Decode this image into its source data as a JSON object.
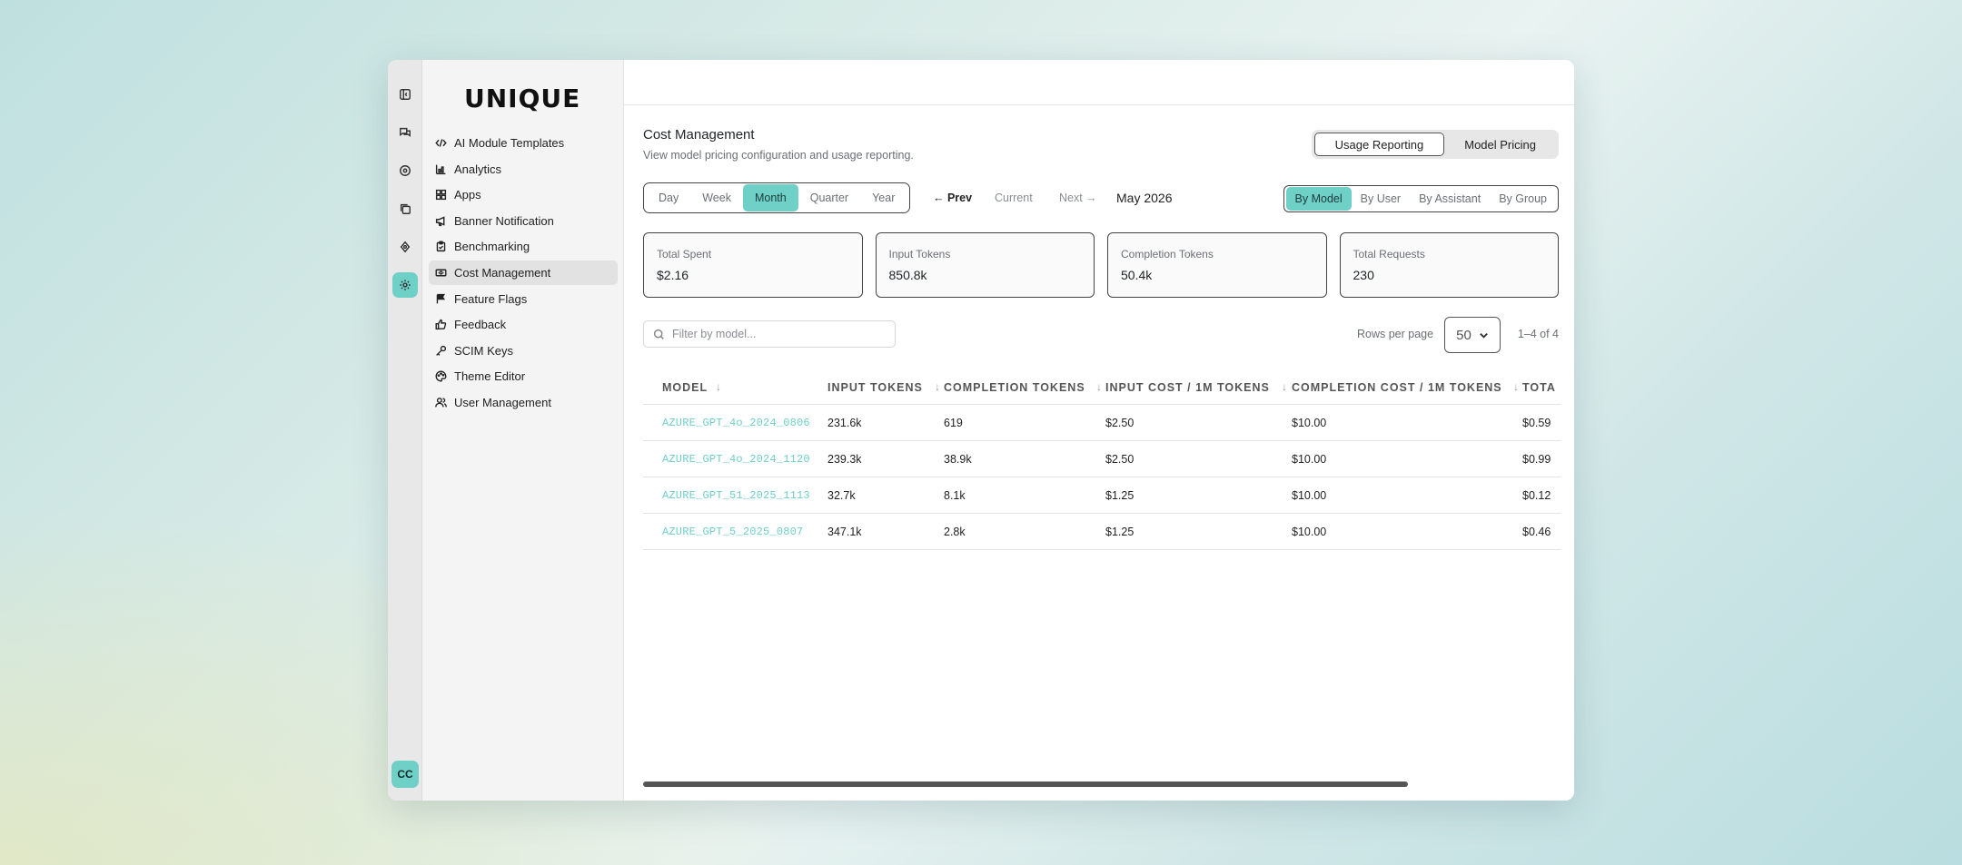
{
  "brand": {
    "logo_text": "UNIQUE",
    "accent": "#6fd0c8"
  },
  "rail": {
    "icons": [
      "collapse-sidebar-icon",
      "chat-icon",
      "explore-icon",
      "copy-icon",
      "ai-icon",
      "settings-icon"
    ],
    "avatar_initials": "CC"
  },
  "sidebar": {
    "items": [
      {
        "label": "AI Module Templates",
        "icon": "code-icon"
      },
      {
        "label": "Analytics",
        "icon": "bar-chart-icon"
      },
      {
        "label": "Apps",
        "icon": "grid-icon"
      },
      {
        "label": "Banner Notification",
        "icon": "megaphone-icon"
      },
      {
        "label": "Benchmarking",
        "icon": "clipboard-check-icon"
      },
      {
        "label": "Cost Management",
        "icon": "money-icon",
        "active": true
      },
      {
        "label": "Feature Flags",
        "icon": "flag-icon"
      },
      {
        "label": "Feedback",
        "icon": "thumbs-up-icon"
      },
      {
        "label": "SCIM Keys",
        "icon": "key-icon"
      },
      {
        "label": "Theme Editor",
        "icon": "palette-icon"
      },
      {
        "label": "User Management",
        "icon": "users-icon"
      }
    ]
  },
  "page": {
    "title": "Cost Management",
    "subtitle": "View model pricing configuration and usage reporting."
  },
  "view_toggle": {
    "usage_label": "Usage Reporting",
    "pricing_label": "Model Pricing",
    "selected": "Usage Reporting"
  },
  "period": {
    "options": [
      "Day",
      "Week",
      "Month",
      "Quarter",
      "Year"
    ],
    "selected": "Month",
    "prev_label": "← Prev",
    "current_label": "Current",
    "next_label": "Next →",
    "current_period": "May 2026"
  },
  "group_by": {
    "options": [
      "By Model",
      "By User",
      "By Assistant",
      "By Group"
    ],
    "selected": "By Model"
  },
  "stats": [
    {
      "label": "Total Spent",
      "value": "$2.16"
    },
    {
      "label": "Input Tokens",
      "value": "850.8k"
    },
    {
      "label": "Completion Tokens",
      "value": "50.4k"
    },
    {
      "label": "Total Requests",
      "value": "230"
    }
  ],
  "filter": {
    "placeholder": "Filter by model..."
  },
  "pagination": {
    "rows_label": "Rows per page",
    "rows_value": "50",
    "range": "1–4 of 4"
  },
  "table": {
    "headers": [
      "MODEL",
      "INPUT TOKENS",
      "COMPLETION TOKENS",
      "INPUT COST / 1M TOKENS",
      "COMPLETION COST / 1M TOKENS",
      "TOTA"
    ],
    "rows": [
      [
        "AZURE_GPT_4o_2024_0806",
        "231.6k",
        "619",
        "$2.50",
        "$10.00",
        "$0.59"
      ],
      [
        "AZURE_GPT_4o_2024_1120",
        "239.3k",
        "38.9k",
        "$2.50",
        "$10.00",
        "$0.99"
      ],
      [
        "AZURE_GPT_51_2025_1113",
        "32.7k",
        "8.1k",
        "$1.25",
        "$10.00",
        "$0.12"
      ],
      [
        "AZURE_GPT_5_2025_0807",
        "347.1k",
        "2.8k",
        "$1.25",
        "$10.00",
        "$0.46"
      ]
    ]
  }
}
